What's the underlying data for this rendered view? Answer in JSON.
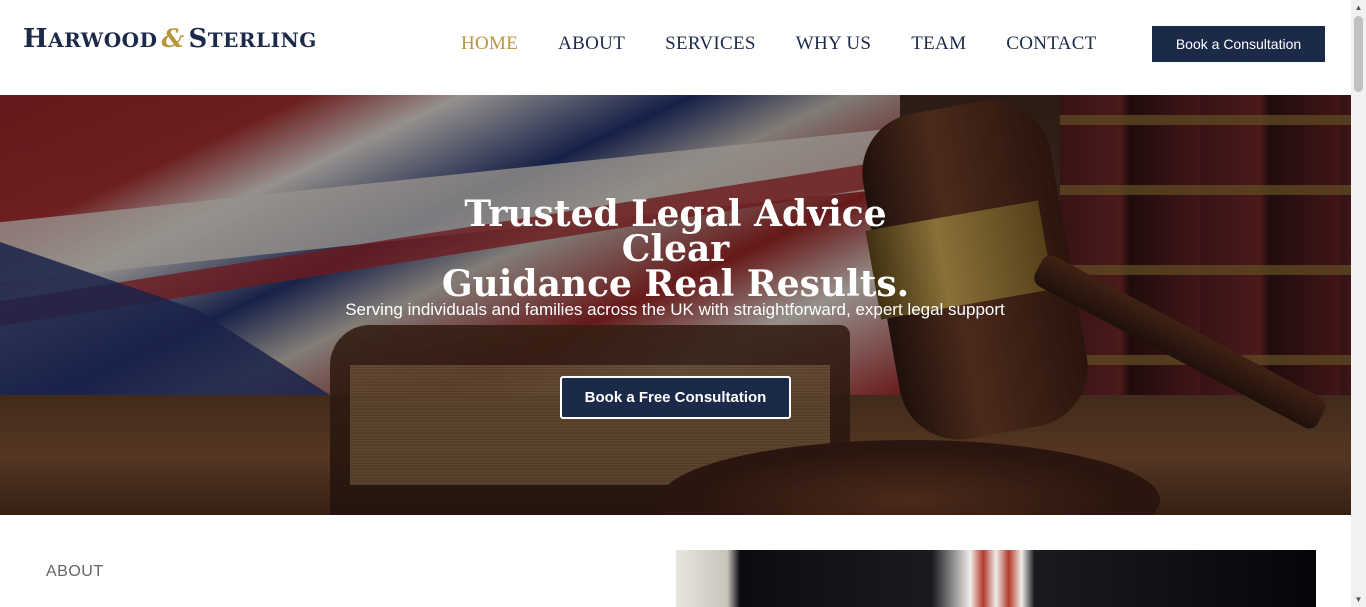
{
  "brand": {
    "logo_h": "H",
    "logo_arwood": "ARWOOD",
    "logo_amp": "&",
    "logo_s": "S",
    "logo_terling": "TERLING",
    "accent": "#b8963e",
    "navy": "#1c2a4a"
  },
  "nav": {
    "items": [
      {
        "label": "HOME",
        "active": true
      },
      {
        "label": "ABOUT",
        "active": false
      },
      {
        "label": "SERVICES",
        "active": false
      },
      {
        "label": "WHY US",
        "active": false
      },
      {
        "label": "TEAM",
        "active": false
      },
      {
        "label": "CONTACT",
        "active": false
      }
    ],
    "cta_label": "Book a Consultation"
  },
  "hero": {
    "title_line1": "Trusted Legal Advice Clear",
    "title_line2": "Guidance Real Results.",
    "subtitle": "Serving individuals and families across the UK with straightforward, expert legal support",
    "button_label": "Book a Free Consultation"
  },
  "about": {
    "section_label": "ABOUT"
  }
}
